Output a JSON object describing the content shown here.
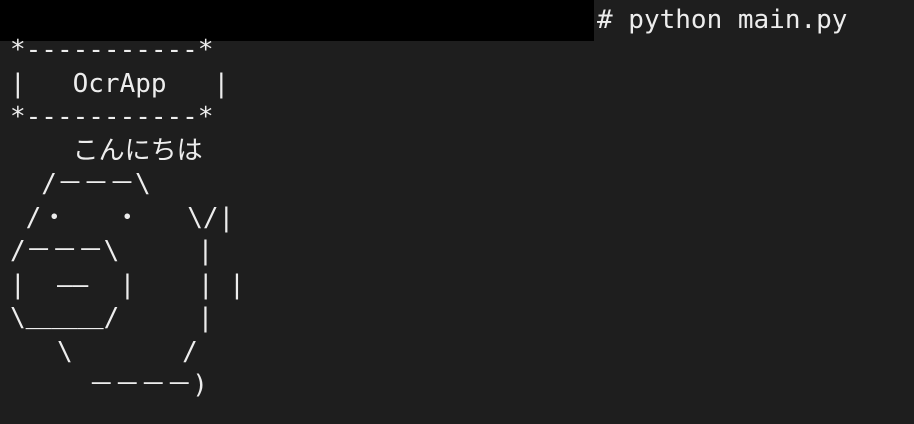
{
  "terminal": {
    "command_line": "# python main.py",
    "output_lines": [
      "*-----------*",
      "|   OcrApp   |",
      "*-----------*",
      "    こんにちは",
      "  /－－－\\",
      " /・   ・   \\/|",
      "/－－－\\     |",
      "|  ——  |    | |",
      "\\＿＿＿/     |",
      "   \\       /",
      "     －－－－)"
    ]
  },
  "colors": {
    "background": "#1e1e1e",
    "text": "#ededed",
    "redaction": "#000000"
  }
}
